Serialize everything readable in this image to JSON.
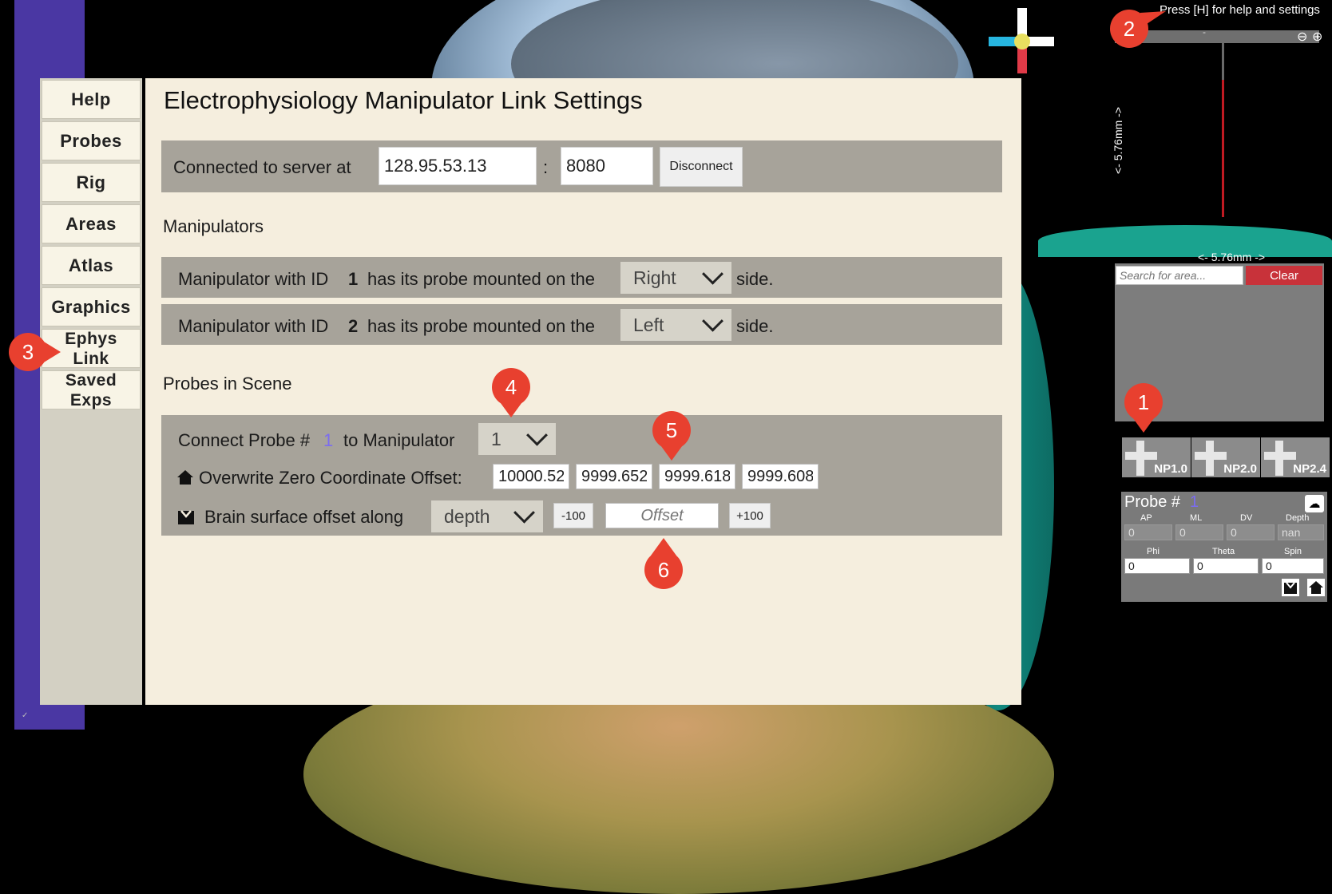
{
  "window": {
    "help_hint": "Press [H] for help and settings"
  },
  "sidebar": {
    "items": [
      {
        "label": "Help"
      },
      {
        "label": "Probes"
      },
      {
        "label": "Rig"
      },
      {
        "label": "Areas"
      },
      {
        "label": "Atlas"
      },
      {
        "label": "Graphics"
      },
      {
        "label": "Ephys\nLink"
      },
      {
        "label": "Saved\nExps"
      }
    ]
  },
  "settings": {
    "title": "Electrophysiology Manipulator Link Settings",
    "server": {
      "label": "Connected to server at",
      "ip": "128.95.53.13",
      "separator": ":",
      "port": "8080",
      "disconnect_label": "Disconnect"
    },
    "manipulators": {
      "heading": "Manipulators",
      "rows": [
        {
          "prefix": "Manipulator with ID",
          "id": "1",
          "mid": "has its probe mounted on the",
          "side": "Right",
          "suffix": "side."
        },
        {
          "prefix": "Manipulator with ID",
          "id": "2",
          "mid": "has its probe mounted on the",
          "side": "Left",
          "suffix": "side."
        }
      ]
    },
    "probes_in_scene": {
      "heading": "Probes in Scene",
      "connect_prefix": "Connect Probe #",
      "probe_number": "1",
      "connect_suffix": "to Manipulator",
      "manipulator_selected": "1",
      "zero_label": "Overwrite Zero Coordinate Offset:",
      "zero_values": [
        "10000.52",
        "9999.652",
        "9999.618",
        "9999.608"
      ],
      "brain_label": "Brain surface offset along",
      "axis_selected": "depth",
      "minus_label": "-100",
      "offset_placeholder": "Offset",
      "plus_label": "+100"
    }
  },
  "annotations": [
    "1",
    "2",
    "3",
    "4",
    "5",
    "6"
  ],
  "right_panel": {
    "scale_h": "<- 5.76mm ->",
    "scale_v": "<- 5.76mm ->",
    "scale_tick": "-",
    "search_placeholder": "Search for area...",
    "clear_label": "Clear",
    "probe_types": [
      "NP1.0",
      "NP2.0",
      "NP2.4"
    ],
    "probe_title": "Probe #",
    "probe_number": "1",
    "coord_labels": [
      "AP",
      "ML",
      "DV",
      "Depth"
    ],
    "coord_values": [
      "0",
      "0",
      "0",
      "nan"
    ],
    "angle_labels": [
      "Phi",
      "Theta",
      "Spin"
    ],
    "angle_values": [
      "0",
      "0",
      "0"
    ]
  },
  "colors": {
    "accent_purple": "#4a37a3",
    "annotation_red": "#e8402f",
    "clear_red": "#c8323a",
    "probe_number": "#7b6cf0"
  }
}
